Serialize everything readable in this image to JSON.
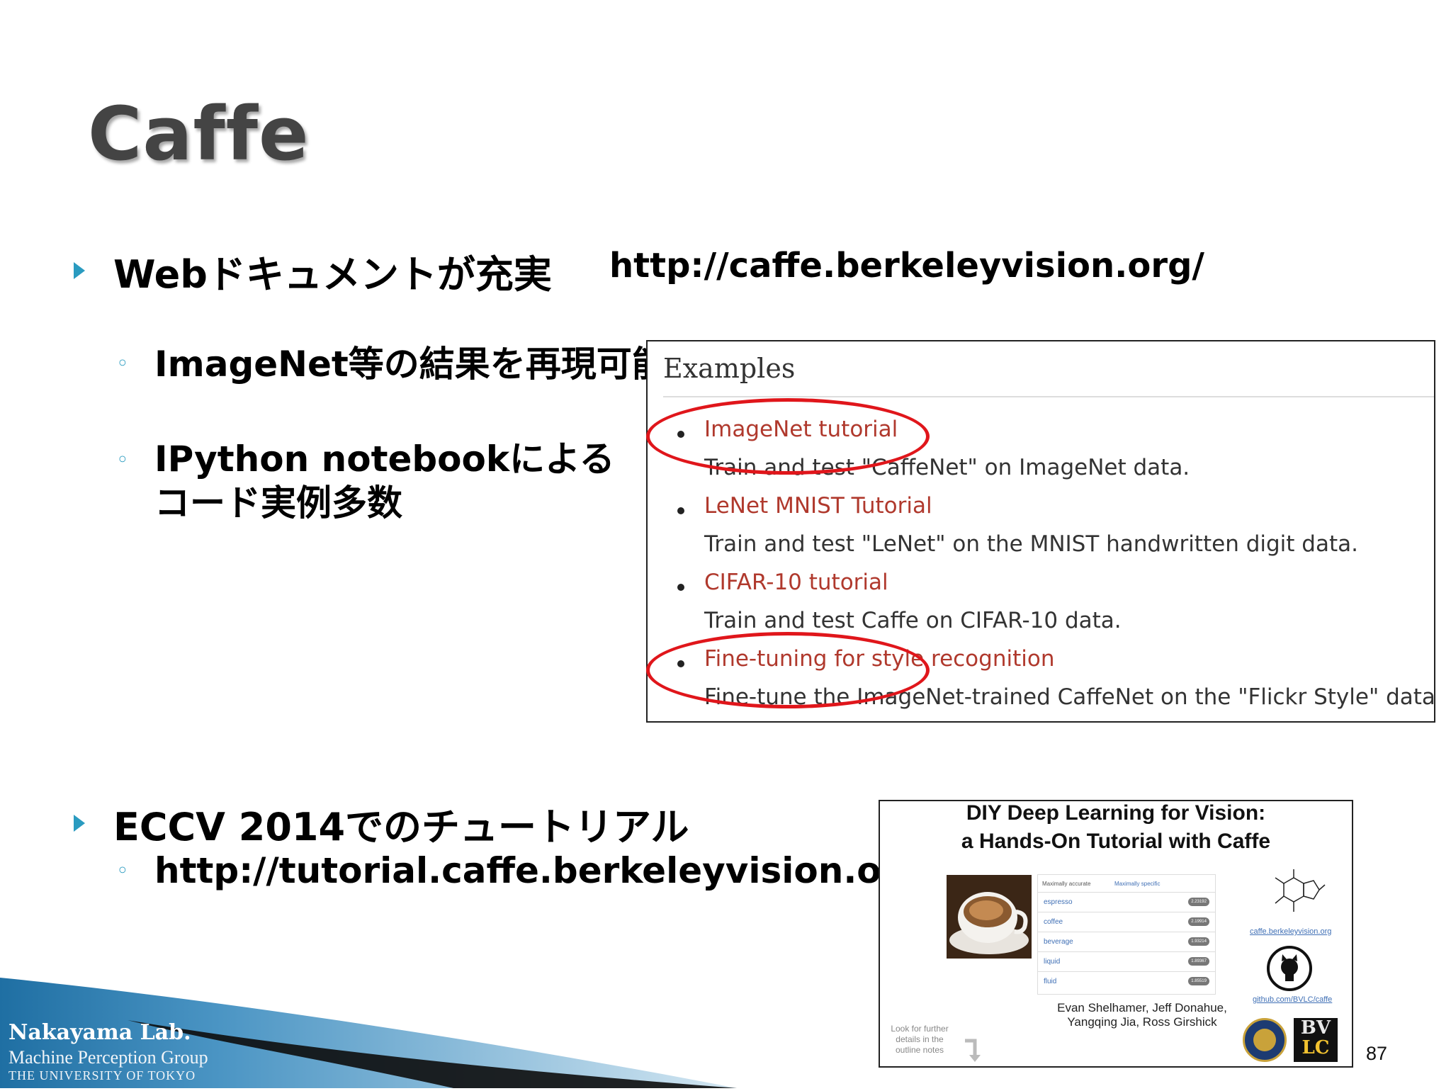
{
  "slide": {
    "title": "Caffe",
    "page_number": "87"
  },
  "bullets": {
    "web_docs": "Webドキュメントが充実",
    "web_url": "http://caffe.berkeleyvision.org/",
    "sub1": "ImageNet等の結果を再現可能",
    "sub2_line1": "IPython notebookによる",
    "sub2_line2": "コード実例多数",
    "eccv": "ECCV 2014でのチュートリアル",
    "eccv_url": "http://tutorial.caffe.berkeleyvision.org/"
  },
  "examples": {
    "heading": "Examples",
    "items": [
      {
        "link": "ImageNet tutorial",
        "desc": "Train and test \"CaffeNet\" on ImageNet data."
      },
      {
        "link": "LeNet MNIST Tutorial",
        "desc": "Train and test \"LeNet\" on the MNIST handwritten digit data."
      },
      {
        "link": "CIFAR-10 tutorial",
        "desc": "Train and test Caffe on CIFAR-10 data."
      },
      {
        "link": "Fine-tuning for style recognition",
        "desc": "Fine-tune the ImageNet-trained CaffeNet on the \"Flickr Style\" dataset."
      }
    ],
    "highlight_color": "#e0161b",
    "link_color": "#b0392d"
  },
  "tutorial": {
    "title_line1": "DIY Deep Learning for Vision:",
    "title_line2": "a Hands-On Tutorial with Caffe",
    "tab1": "Maximally accurate",
    "tab2": "Maximally specific",
    "rows": [
      {
        "label": "espresso",
        "score": "2.23192"
      },
      {
        "label": "coffee",
        "score": "2.19914"
      },
      {
        "label": "beverage",
        "score": "1.93214"
      },
      {
        "label": "liquid",
        "score": "1.89367"
      },
      {
        "label": "fluid",
        "score": "1.85519"
      }
    ],
    "link_site": "caffe.berkeleyvision.org",
    "link_github": "github.com/BVLC/caffe",
    "authors_line1": "Evan Shelhamer, Jeff Donahue,",
    "authors_line2": "Yangqing Jia, Ross Girshick",
    "note_line1": "Look for further",
    "note_line2": "details in the",
    "note_line3": "outline notes",
    "logo_line1": "BV",
    "logo_line2": "LC"
  },
  "footer": {
    "lab": "Nakayama Lab.",
    "group": "Machine Perception Group",
    "university": "THE UNIVERSITY OF TOKYO"
  },
  "colors": {
    "accent": "#2a9bc0",
    "title": "#444444",
    "footer_blue": "#1f6fa3"
  }
}
